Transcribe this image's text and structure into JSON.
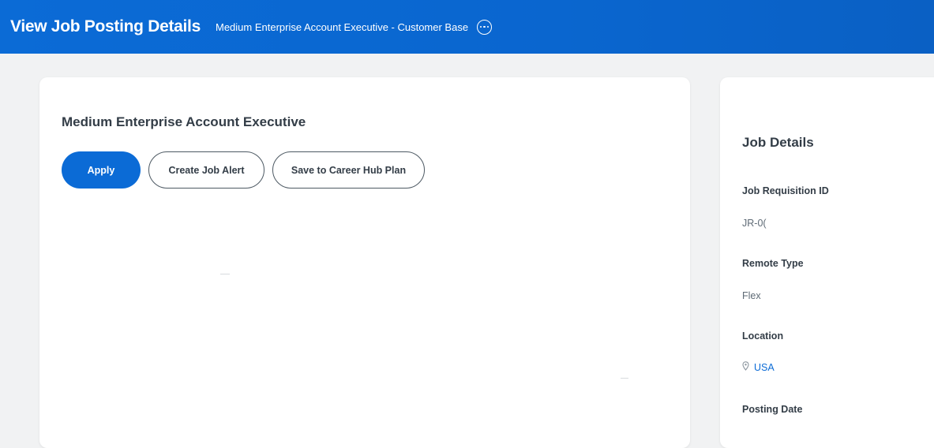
{
  "header": {
    "title": "View Job Posting Details",
    "subtitle": "Medium Enterprise Account Executive - Customer Base",
    "more_icon": "more-horizontal-circle-icon"
  },
  "main": {
    "job_title": "Medium Enterprise Account Executive",
    "actions": {
      "apply_label": "Apply",
      "alert_label": "Create Job Alert",
      "save_label": "Save to Career Hub Plan"
    }
  },
  "side": {
    "heading": "Job Details",
    "fields": [
      {
        "label": "Job Requisition ID",
        "value": "JR-0("
      },
      {
        "label": "Remote Type",
        "value": "Flex"
      },
      {
        "label": "Location",
        "value": "USA",
        "icon": "location-pin-icon"
      },
      {
        "label": "Posting Date",
        "value": ""
      }
    ]
  },
  "colors": {
    "brand_blue": "#0b6bd6",
    "background": "#f1f2f3",
    "card": "#ffffff",
    "text": "#333d47"
  }
}
